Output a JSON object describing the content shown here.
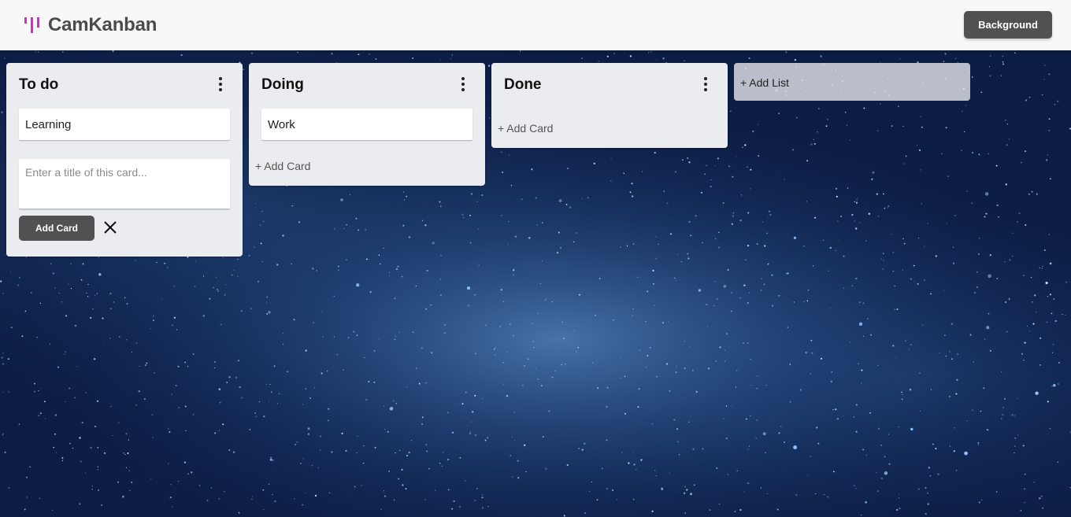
{
  "header": {
    "brand": "CamKanban",
    "background_button": "Background"
  },
  "lists": [
    {
      "title": "To do",
      "cards": [
        "Learning"
      ],
      "composer": {
        "placeholder": "Enter a title of this card...",
        "add_button": "Add Card"
      }
    },
    {
      "title": "Doing",
      "cards": [
        "Work"
      ],
      "add_card_label": "+ Add Card"
    },
    {
      "title": "Done",
      "cards": [],
      "add_card_label": "+ Add Card"
    }
  ],
  "add_list_label": "+ Add List",
  "colors": {
    "brand_accent": "#d62ad0",
    "header_bg": "#f8f8f8",
    "button_bg": "#515151",
    "list_bg": "#ebecf0",
    "board_bg": "#0a1a3d"
  },
  "icons": [
    "logo-icon",
    "more-vertical-icon",
    "close-icon"
  ]
}
